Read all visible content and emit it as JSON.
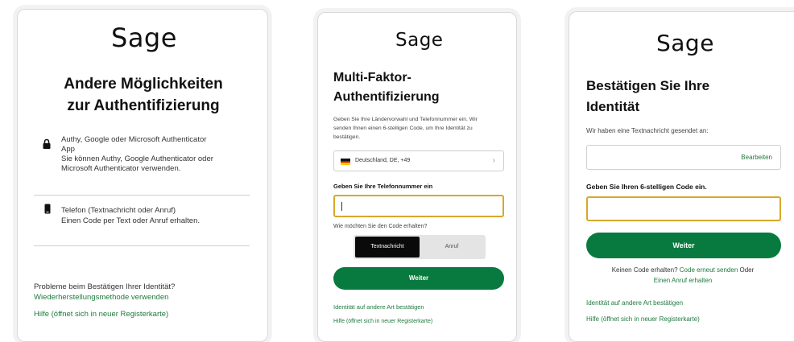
{
  "panel1": {
    "logo": "Sage",
    "heading_line1": "Andere Möglichkeiten",
    "heading_line2": "zur Authentifizierung",
    "option1": {
      "title_line1": "Authy, Google oder Microsoft Authenticator",
      "title_line2": "App",
      "desc_line1": "Sie können Authy, Google Authenticator oder",
      "desc_line2": "Microsoft Authenticator verwenden.",
      "icon": "lock-icon"
    },
    "option2": {
      "title": "Telefon (Textnachricht oder Anruf)",
      "desc": "Einen Code per Text oder Anruf erhalten.",
      "icon": "phone-icon"
    },
    "problems_text": "Probleme beim Bestätigen Ihrer Identität?",
    "recovery_link": "Wiederherstellungsmethode verwenden",
    "help_link": "Hilfe (öffnet sich in neuer Registerkarte)"
  },
  "panel2": {
    "logo": "Sage",
    "heading_line1": "Multi-Faktor-",
    "heading_line2": "Authentifizierung",
    "intro_line1": "Geben Sie Ihre Ländervorwahl und Telefonnummer ein. Wir",
    "intro_line2": "senden Ihnen einen 6-stelligen Code, um Ihre Identität zu",
    "intro_line3": "bestätigen.",
    "country_value": "Deutschland, DE, +49",
    "phone_label": "Geben Sie Ihre Telefonnummer ein",
    "phone_value": "",
    "method_question": "Wie möchten Sie den Code erhalten?",
    "method_options": [
      "Textnachricht",
      "Anruf"
    ],
    "method_selected": "Textnachricht",
    "continue_button": "Weiter",
    "other_method_link": "Identität auf andere Art bestätigen",
    "help_link": "Hilfe (öffnet sich in neuer Registerkarte)"
  },
  "panel3": {
    "logo": "Sage",
    "heading_line1": "Bestätigen Sie Ihre",
    "heading_line2": "Identität",
    "sent_text": "Wir haben eine Textnachricht gesendet an:",
    "edit_link": "Bearbeiten",
    "code_label": "Geben Sie Ihren 6-stelligen Code ein.",
    "code_value": "",
    "continue_button": "Weiter",
    "no_code_text": "Keinen Code erhalten?",
    "resend_link": "Code erneut senden",
    "or_text": "Oder",
    "call_link": "Einen Anruf erhalten",
    "other_method_link": "Identität auf andere Art bestätigen",
    "help_link": "Hilfe (öffnet sich in neuer Registerkarte)"
  },
  "colors": {
    "brand_green": "#087a3f",
    "link_green": "#1f7a3e",
    "focus_gold": "#d7a82a"
  }
}
